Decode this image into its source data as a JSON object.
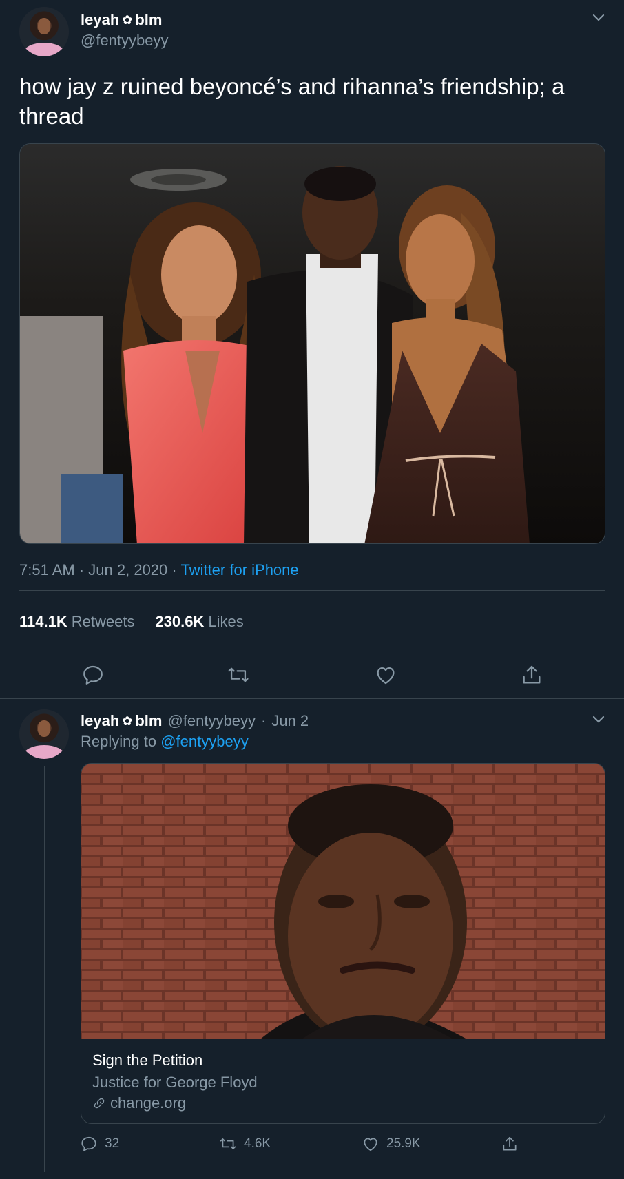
{
  "main_tweet": {
    "display_name": "leyah",
    "flower_glyph": "✿",
    "display_name_suffix": "blm",
    "handle": "@fentyybeyy",
    "text": "how jay z ruined beyoncé’s and rihanna’s friendship; a thread",
    "time": "7:51 AM",
    "date": "Jun 2, 2020",
    "separator": "·",
    "source": "Twitter for iPhone",
    "retweets_count": "114.1K",
    "retweets_label": "Retweets",
    "likes_count": "230.6K",
    "likes_label": "Likes"
  },
  "reply_tweet": {
    "display_name": "leyah",
    "flower_glyph": "✿",
    "display_name_suffix": "blm",
    "handle": "@fentyybeyy",
    "separator": "·",
    "date": "Jun 2",
    "replying_label": "Replying to",
    "replying_handle": "@fentyybeyy",
    "card": {
      "title": "Sign the Petition",
      "description": "Justice for George Floyd",
      "domain": "change.org"
    },
    "reply_count": "32",
    "retweet_count": "4.6K",
    "like_count": "25.9K"
  },
  "icons": [
    "chevron-down-icon",
    "reply-icon",
    "retweet-icon",
    "like-icon",
    "share-icon",
    "link-icon"
  ],
  "colors": {
    "background": "#15202b",
    "border": "#38444d",
    "secondary_text": "#8899a6",
    "accent": "#1da1f2"
  }
}
